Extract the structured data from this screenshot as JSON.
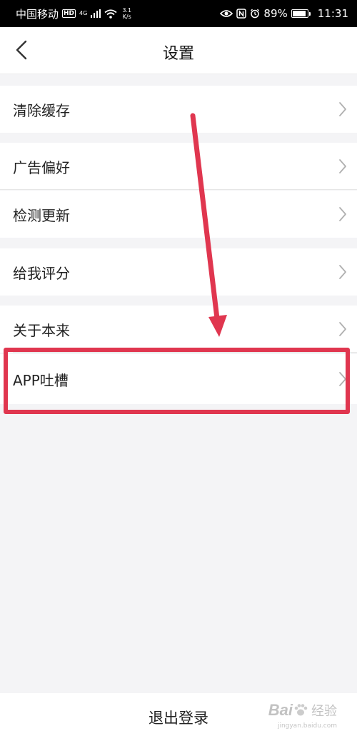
{
  "status_bar": {
    "carrier": "中国移动",
    "hd": "HD",
    "network": "4G",
    "speed_top": "3.1",
    "speed_bottom": "K/s",
    "battery": "89%",
    "battery_level": 0.89,
    "time": "11:31"
  },
  "header": {
    "title": "设置"
  },
  "settings": {
    "clear_cache": "清除缓存",
    "ad_preference": "广告偏好",
    "check_update": "检测更新",
    "rate_us": "给我评分",
    "about": "关于本来",
    "feedback": "APP吐槽"
  },
  "footer": {
    "logout": "退出登录"
  },
  "annotation": {
    "color": "#e0364f"
  },
  "watermark": {
    "brand": "Bai",
    "brand_suffix": "经验",
    "url": "jingyan.baidu.com"
  }
}
